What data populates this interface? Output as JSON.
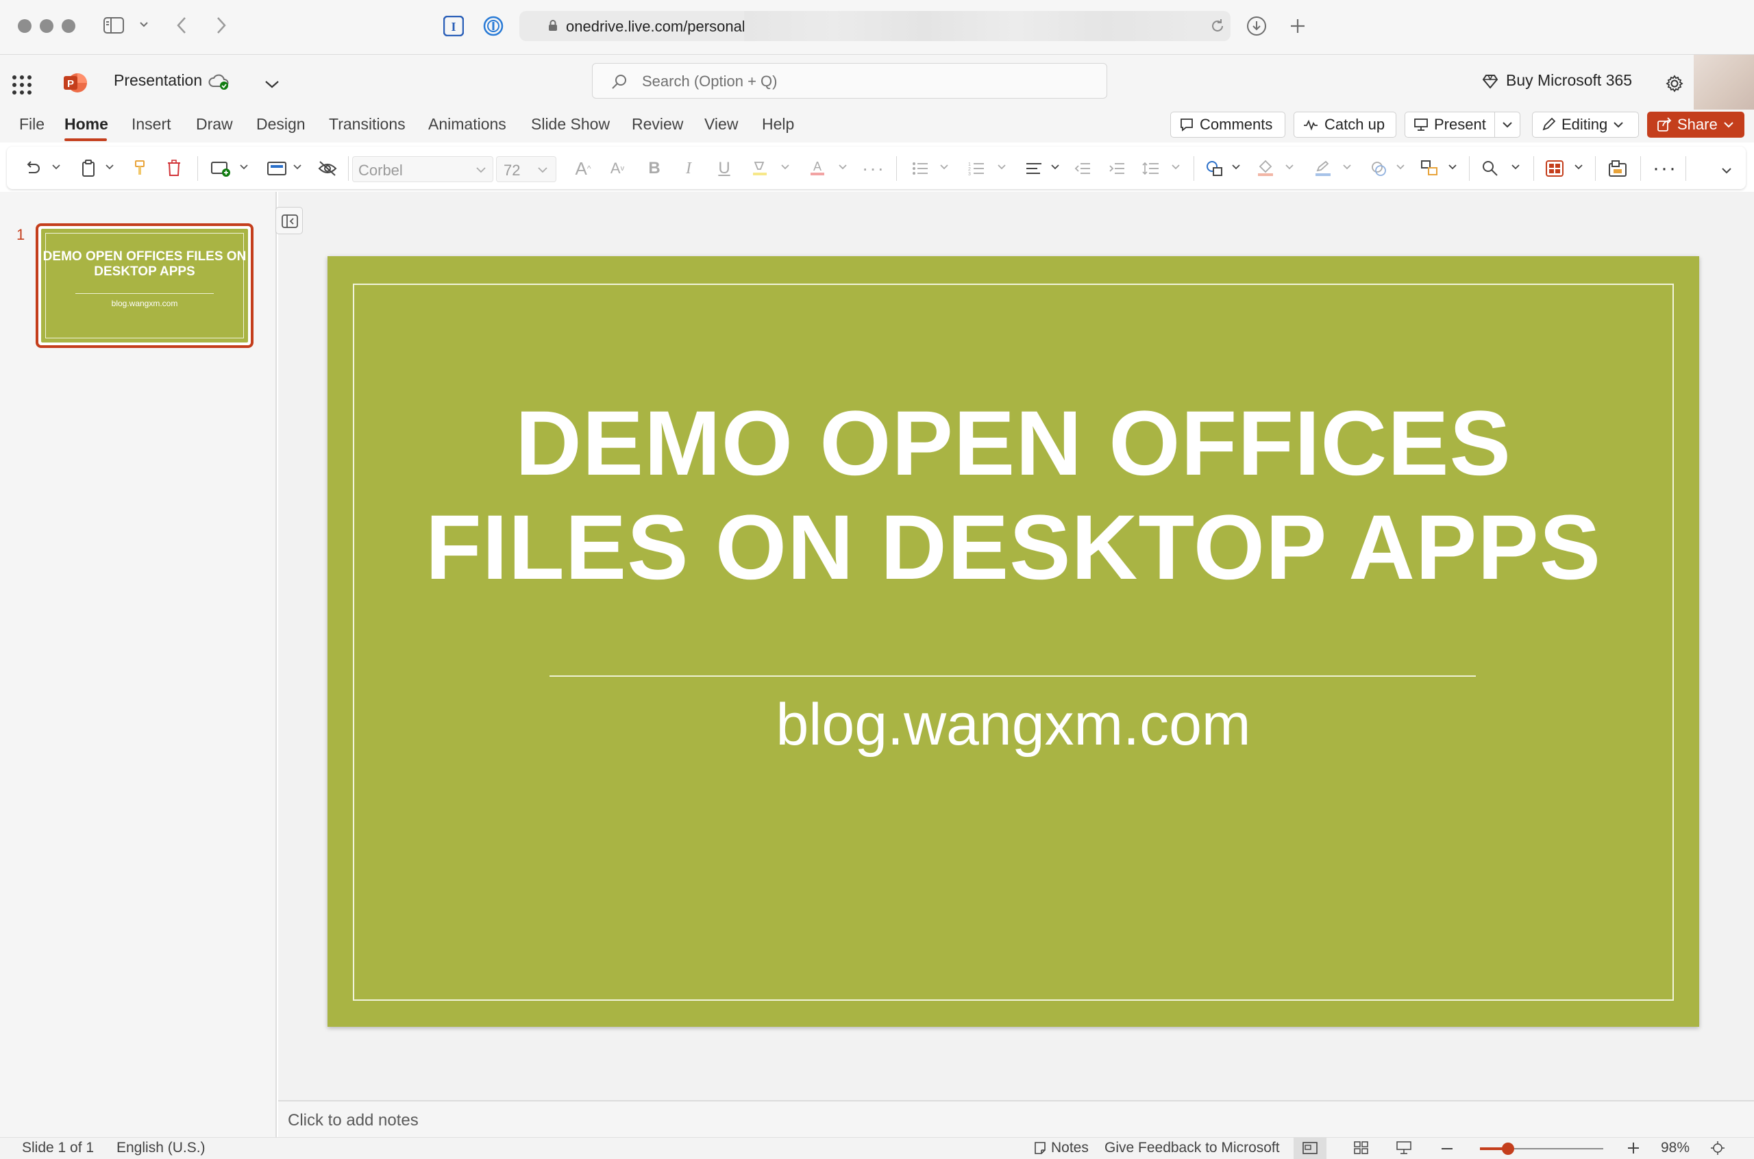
{
  "browser": {
    "url": "onedrive.live.com/personal"
  },
  "app": {
    "document_name": "Presentation",
    "search_placeholder": "Search (Option + Q)",
    "buy_label": "Buy Microsoft 365",
    "accent_color": "#c43e1c",
    "slide_color": "#a9b444"
  },
  "menu": {
    "tabs": [
      "File",
      "Home",
      "Insert",
      "Draw",
      "Design",
      "Transitions",
      "Animations",
      "Slide Show",
      "Review",
      "View",
      "Help"
    ],
    "active_tab": "Home",
    "comments_label": "Comments",
    "catchup_label": "Catch up",
    "present_label": "Present",
    "editing_label": "Editing",
    "share_label": "Share"
  },
  "ribbon": {
    "font_name": "Corbel",
    "font_size": "72"
  },
  "thumbnails": [
    {
      "number": "1",
      "title": "DEMO OPEN OFFICES FILES ON DESKTOP APPS",
      "subtitle": "blog.wangxm.com"
    }
  ],
  "slide": {
    "title_line1": "DEMO OPEN OFFICES",
    "title_line2": "FILES ON DESKTOP APPS",
    "subtitle": "blog.wangxm.com"
  },
  "notes": {
    "placeholder": "Click to add notes"
  },
  "status": {
    "slide_info": "Slide 1 of 1",
    "language": "English (U.S.)",
    "notes_label": "Notes",
    "feedback_label": "Give Feedback to Microsoft",
    "zoom": "98%",
    "zoom_fraction": 0.98
  }
}
